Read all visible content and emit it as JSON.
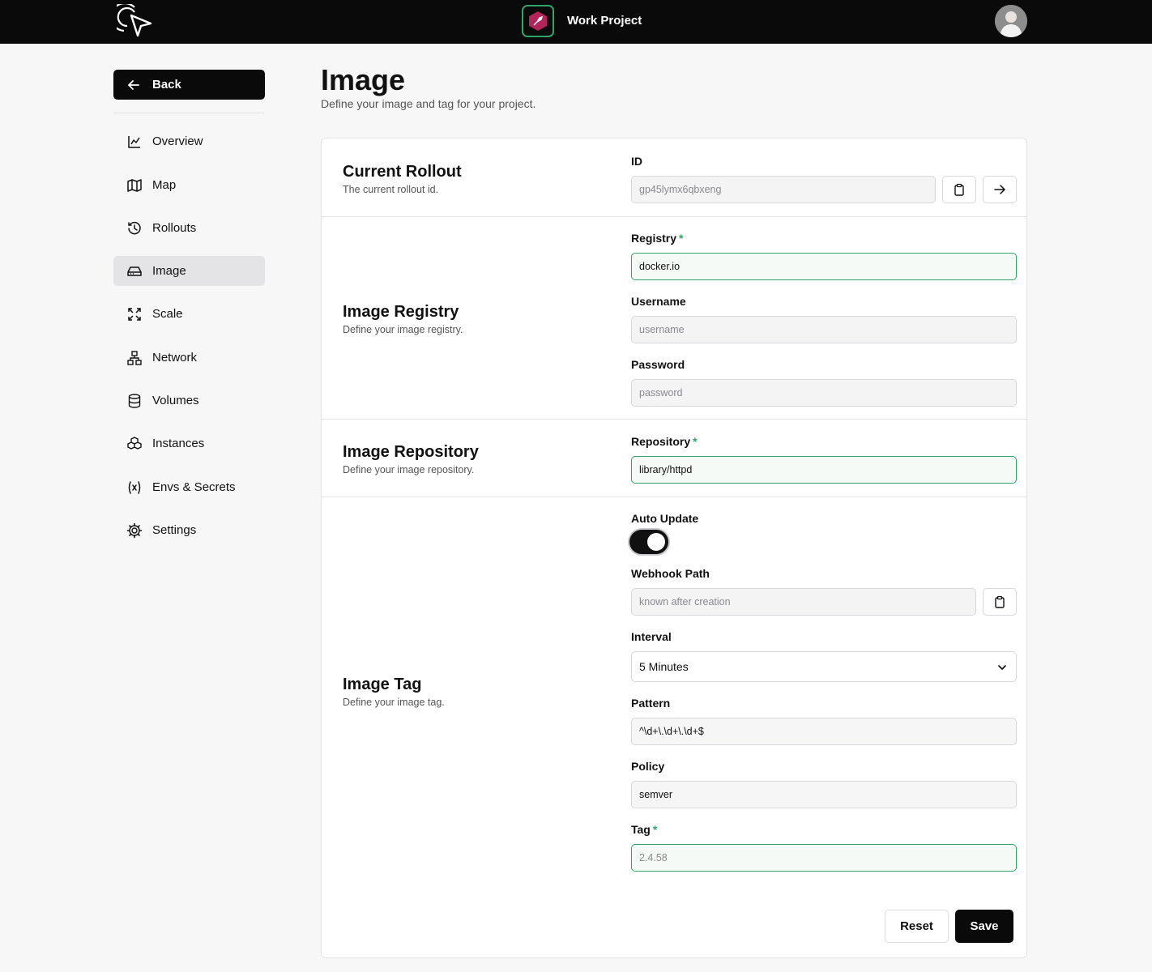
{
  "app": {
    "project_name": "Work Project"
  },
  "sidebar": {
    "back_label": "Back",
    "items": [
      {
        "label": "Overview",
        "icon": "chart-line-icon"
      },
      {
        "label": "Map",
        "icon": "map-icon"
      },
      {
        "label": "Rollouts",
        "icon": "history-icon"
      },
      {
        "label": "Image",
        "icon": "hard-drive-icon",
        "active": true
      },
      {
        "label": "Scale",
        "icon": "expand-icon"
      },
      {
        "label": "Network",
        "icon": "network-icon"
      },
      {
        "label": "Volumes",
        "icon": "database-icon"
      },
      {
        "label": "Instances",
        "icon": "boxes-icon"
      },
      {
        "label": "Envs & Secrets",
        "icon": "variable-icon"
      },
      {
        "label": "Settings",
        "icon": "gear-icon"
      }
    ]
  },
  "page": {
    "title": "Image",
    "subtitle": "Define your image and tag for your project."
  },
  "rollout": {
    "title": "Current Rollout",
    "desc": "The current rollout id.",
    "id_label": "ID",
    "id_placeholder": "gp45lymx6qbxeng"
  },
  "registry": {
    "title": "Image Registry",
    "desc": "Define your image registry.",
    "registry_label": "Registry",
    "required_mark": "*",
    "registry_value": "docker.io",
    "username_label": "Username",
    "username_placeholder": "username",
    "password_label": "Password",
    "password_placeholder": "password"
  },
  "repository": {
    "title": "Image Repository",
    "desc": "Define your image repository.",
    "repository_label": "Repository",
    "required_mark": "*",
    "repository_value": "library/httpd"
  },
  "tag": {
    "title": "Image Tag",
    "desc": "Define your image tag.",
    "auto_update_label": "Auto Update",
    "auto_update_on": true,
    "webhook_label": "Webhook Path",
    "webhook_placeholder": "known after creation",
    "interval_label": "Interval",
    "interval_value": "5 Minutes",
    "pattern_label": "Pattern",
    "pattern_value": "^\\d+\\.\\d+\\.\\d+$",
    "policy_label": "Policy",
    "policy_value": "semver",
    "tag_label": "Tag",
    "required_mark": "*",
    "tag_placeholder": "2.4.58"
  },
  "actions": {
    "reset_label": "Reset",
    "save_label": "Save"
  },
  "colors": {
    "accent": "#2fa56a",
    "dark": "#0a0a0a",
    "project_badge": "#b2245a"
  }
}
